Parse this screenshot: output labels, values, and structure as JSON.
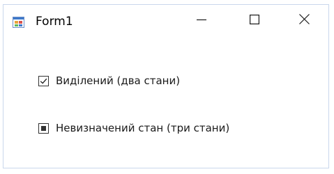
{
  "window": {
    "title": "Form1",
    "icon": "winforms-app-icon",
    "controls": {
      "minimize_icon": "minimize-icon",
      "maximize_icon": "maximize-icon",
      "close_icon": "close-icon"
    }
  },
  "checkboxes": [
    {
      "label": "Виділений (два стани)",
      "state": "checked"
    },
    {
      "label": "Невизначений стан (три стани)",
      "state": "indeterminate"
    }
  ],
  "colors": {
    "border": "#c9d7ec",
    "text": "#1a1a1a",
    "checkbox_border": "#333333"
  }
}
